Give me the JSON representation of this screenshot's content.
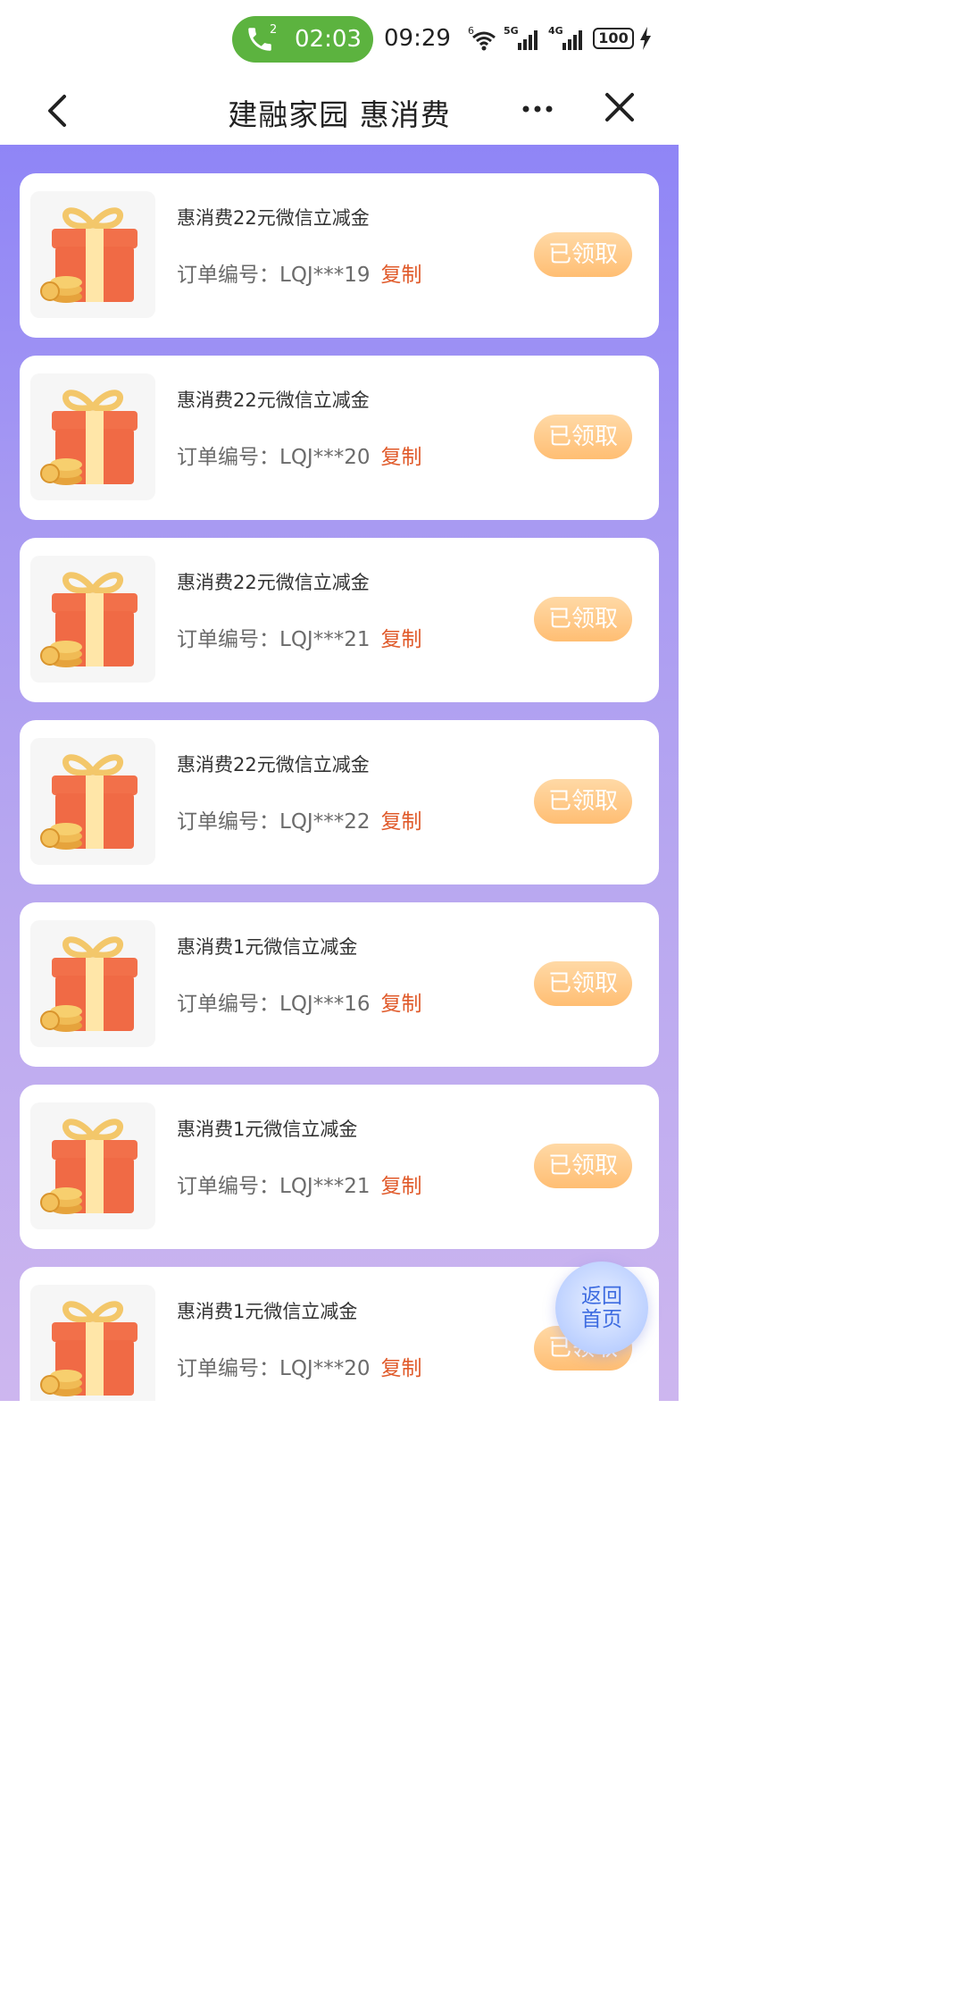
{
  "status_bar": {
    "call_time": "02:03",
    "call_badge": "2",
    "clock": "09:29",
    "battery": "100",
    "wifi_label": "6",
    "signal_1_label": "5G",
    "signal_2_label": "4G"
  },
  "navbar": {
    "title": "建融家园 惠消费"
  },
  "order_prefix": "订单编号：",
  "copy_label": "复制",
  "claimed_label": "已领取",
  "cards": [
    {
      "title": "惠消费22元微信立减金",
      "order_no": "LQJ***19"
    },
    {
      "title": "惠消费22元微信立减金",
      "order_no": "LQJ***20"
    },
    {
      "title": "惠消费22元微信立减金",
      "order_no": "LQJ***21"
    },
    {
      "title": "惠消费22元微信立减金",
      "order_no": "LQJ***22"
    },
    {
      "title": "惠消费1元微信立减金",
      "order_no": "LQJ***16"
    },
    {
      "title": "惠消费1元微信立减金",
      "order_no": "LQJ***21"
    },
    {
      "title": "惠消费1元微信立减金",
      "order_no": "LQJ***20"
    }
  ],
  "float_button": {
    "line1": "返回",
    "line2": "首页"
  },
  "colors": {
    "call_green": "#5cb33f",
    "copy_orange": "#e05a2a",
    "claimed_orange": "#ffbe73",
    "bg_top": "#8f85f6",
    "bg_bottom": "#cdb6ef"
  }
}
